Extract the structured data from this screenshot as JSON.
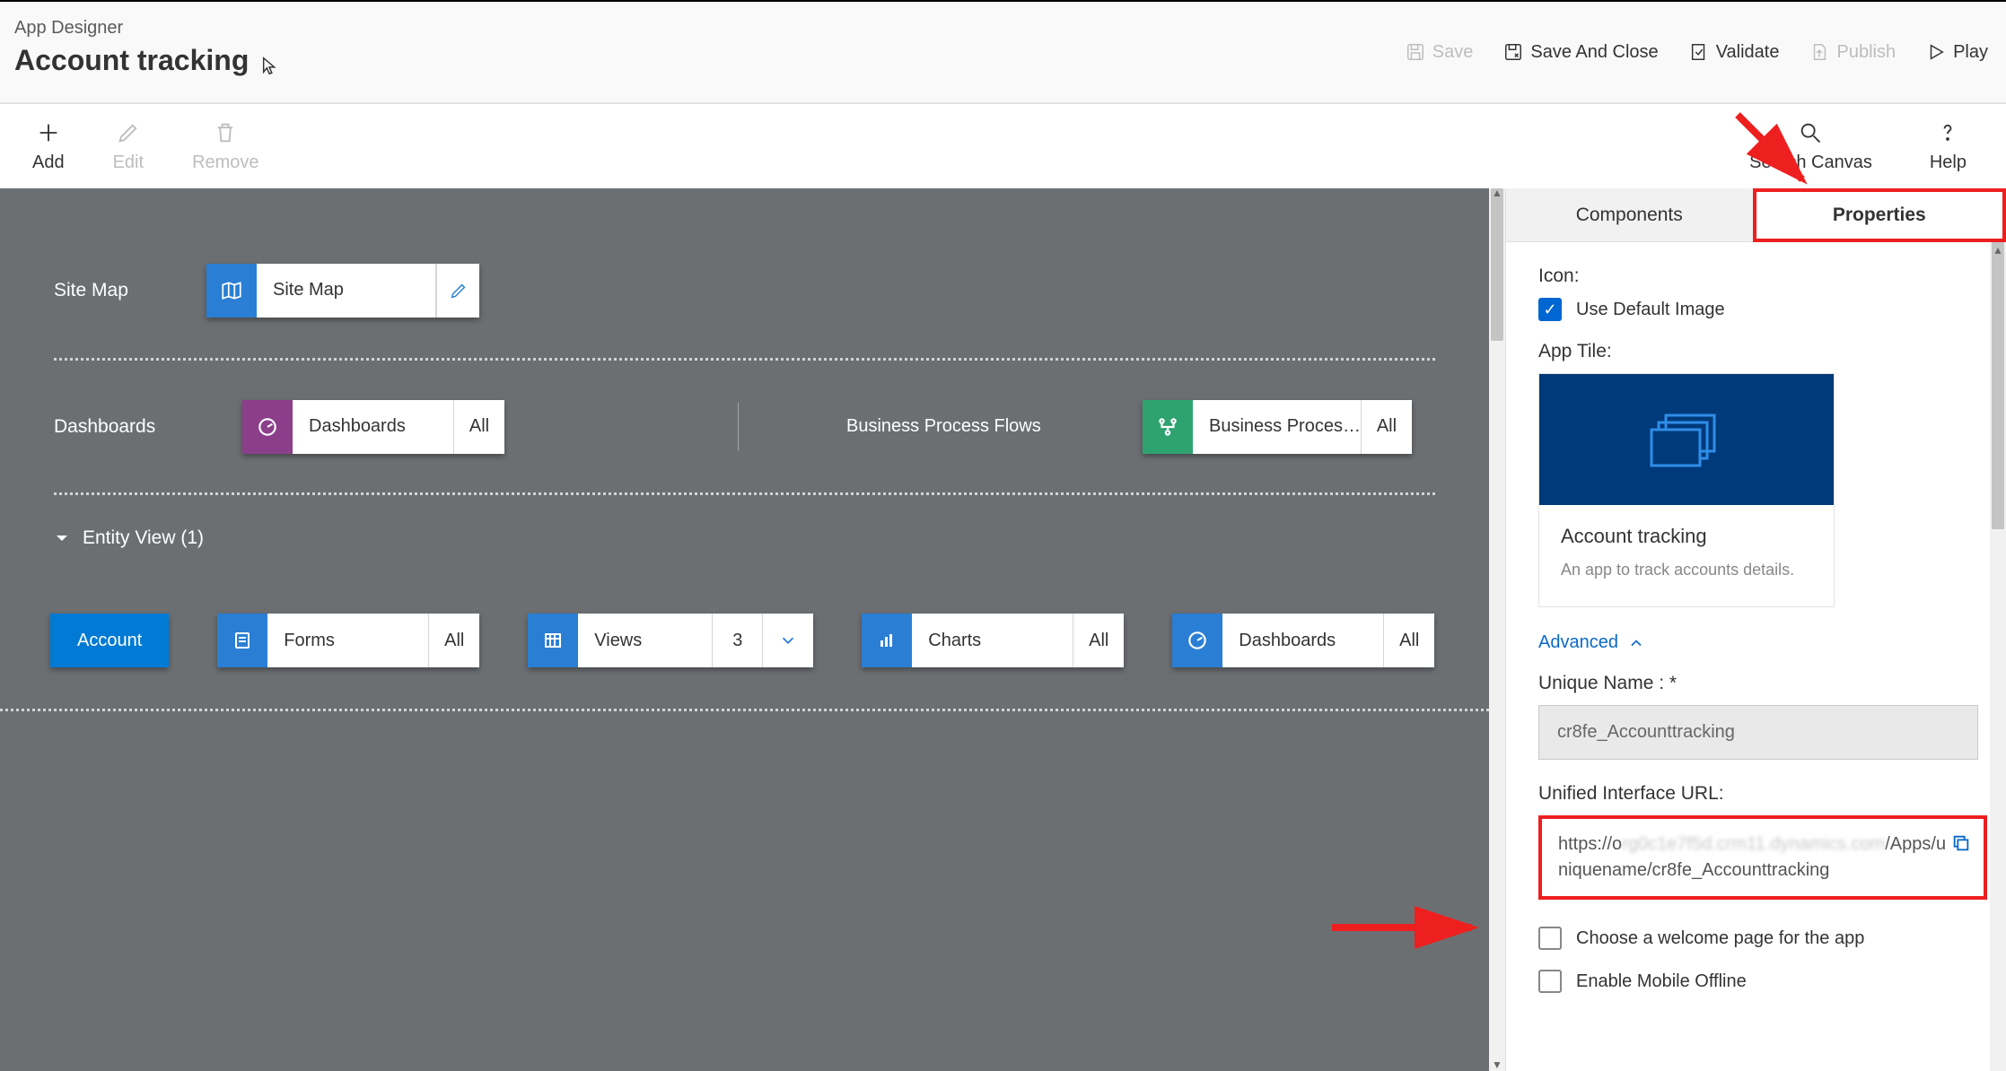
{
  "header": {
    "crumb": "App Designer",
    "title": "Account tracking",
    "save": "Save",
    "save_close": "Save And Close",
    "validate": "Validate",
    "publish": "Publish",
    "play": "Play"
  },
  "toolbar": {
    "add": "Add",
    "edit": "Edit",
    "remove": "Remove",
    "search": "Search Canvas",
    "help": "Help"
  },
  "canvas": {
    "sitemap_section": "Site Map",
    "sitemap_card": "Site Map",
    "dashboards_section": "Dashboards",
    "dashboards_card": "Dashboards",
    "dashboards_tail": "All",
    "bpf_section": "Business Process Flows",
    "bpf_card": "Business Proces…",
    "bpf_tail": "All",
    "entity_header": "Entity View (1)",
    "entity_name": "Account",
    "forms": {
      "label": "Forms",
      "tail": "All"
    },
    "views": {
      "label": "Views",
      "tail": "3"
    },
    "charts": {
      "label": "Charts",
      "tail": "All"
    },
    "edash": {
      "label": "Dashboards",
      "tail": "All"
    }
  },
  "panel": {
    "tab_components": "Components",
    "tab_properties": "Properties",
    "icon_label": "Icon:",
    "use_default": "Use Default Image",
    "apptile_label": "App Tile:",
    "tile_title": "Account tracking",
    "tile_desc": "An app to track accounts details.",
    "advanced": "Advanced",
    "unique_name_label": "Unique Name : *",
    "unique_name_value": "cr8fe_Accounttracking",
    "url_label": "Unified Interface URL:",
    "url_prefix": "https://o",
    "url_blur": "rg0c1e7f5d.crm11.dynamics.com",
    "url_suffix1": "/Apps/u",
    "url_suffix2": "niquename/cr8fe_Accounttracking",
    "welcome": "Choose a welcome page for the app",
    "mobile": "Enable Mobile Offline"
  }
}
